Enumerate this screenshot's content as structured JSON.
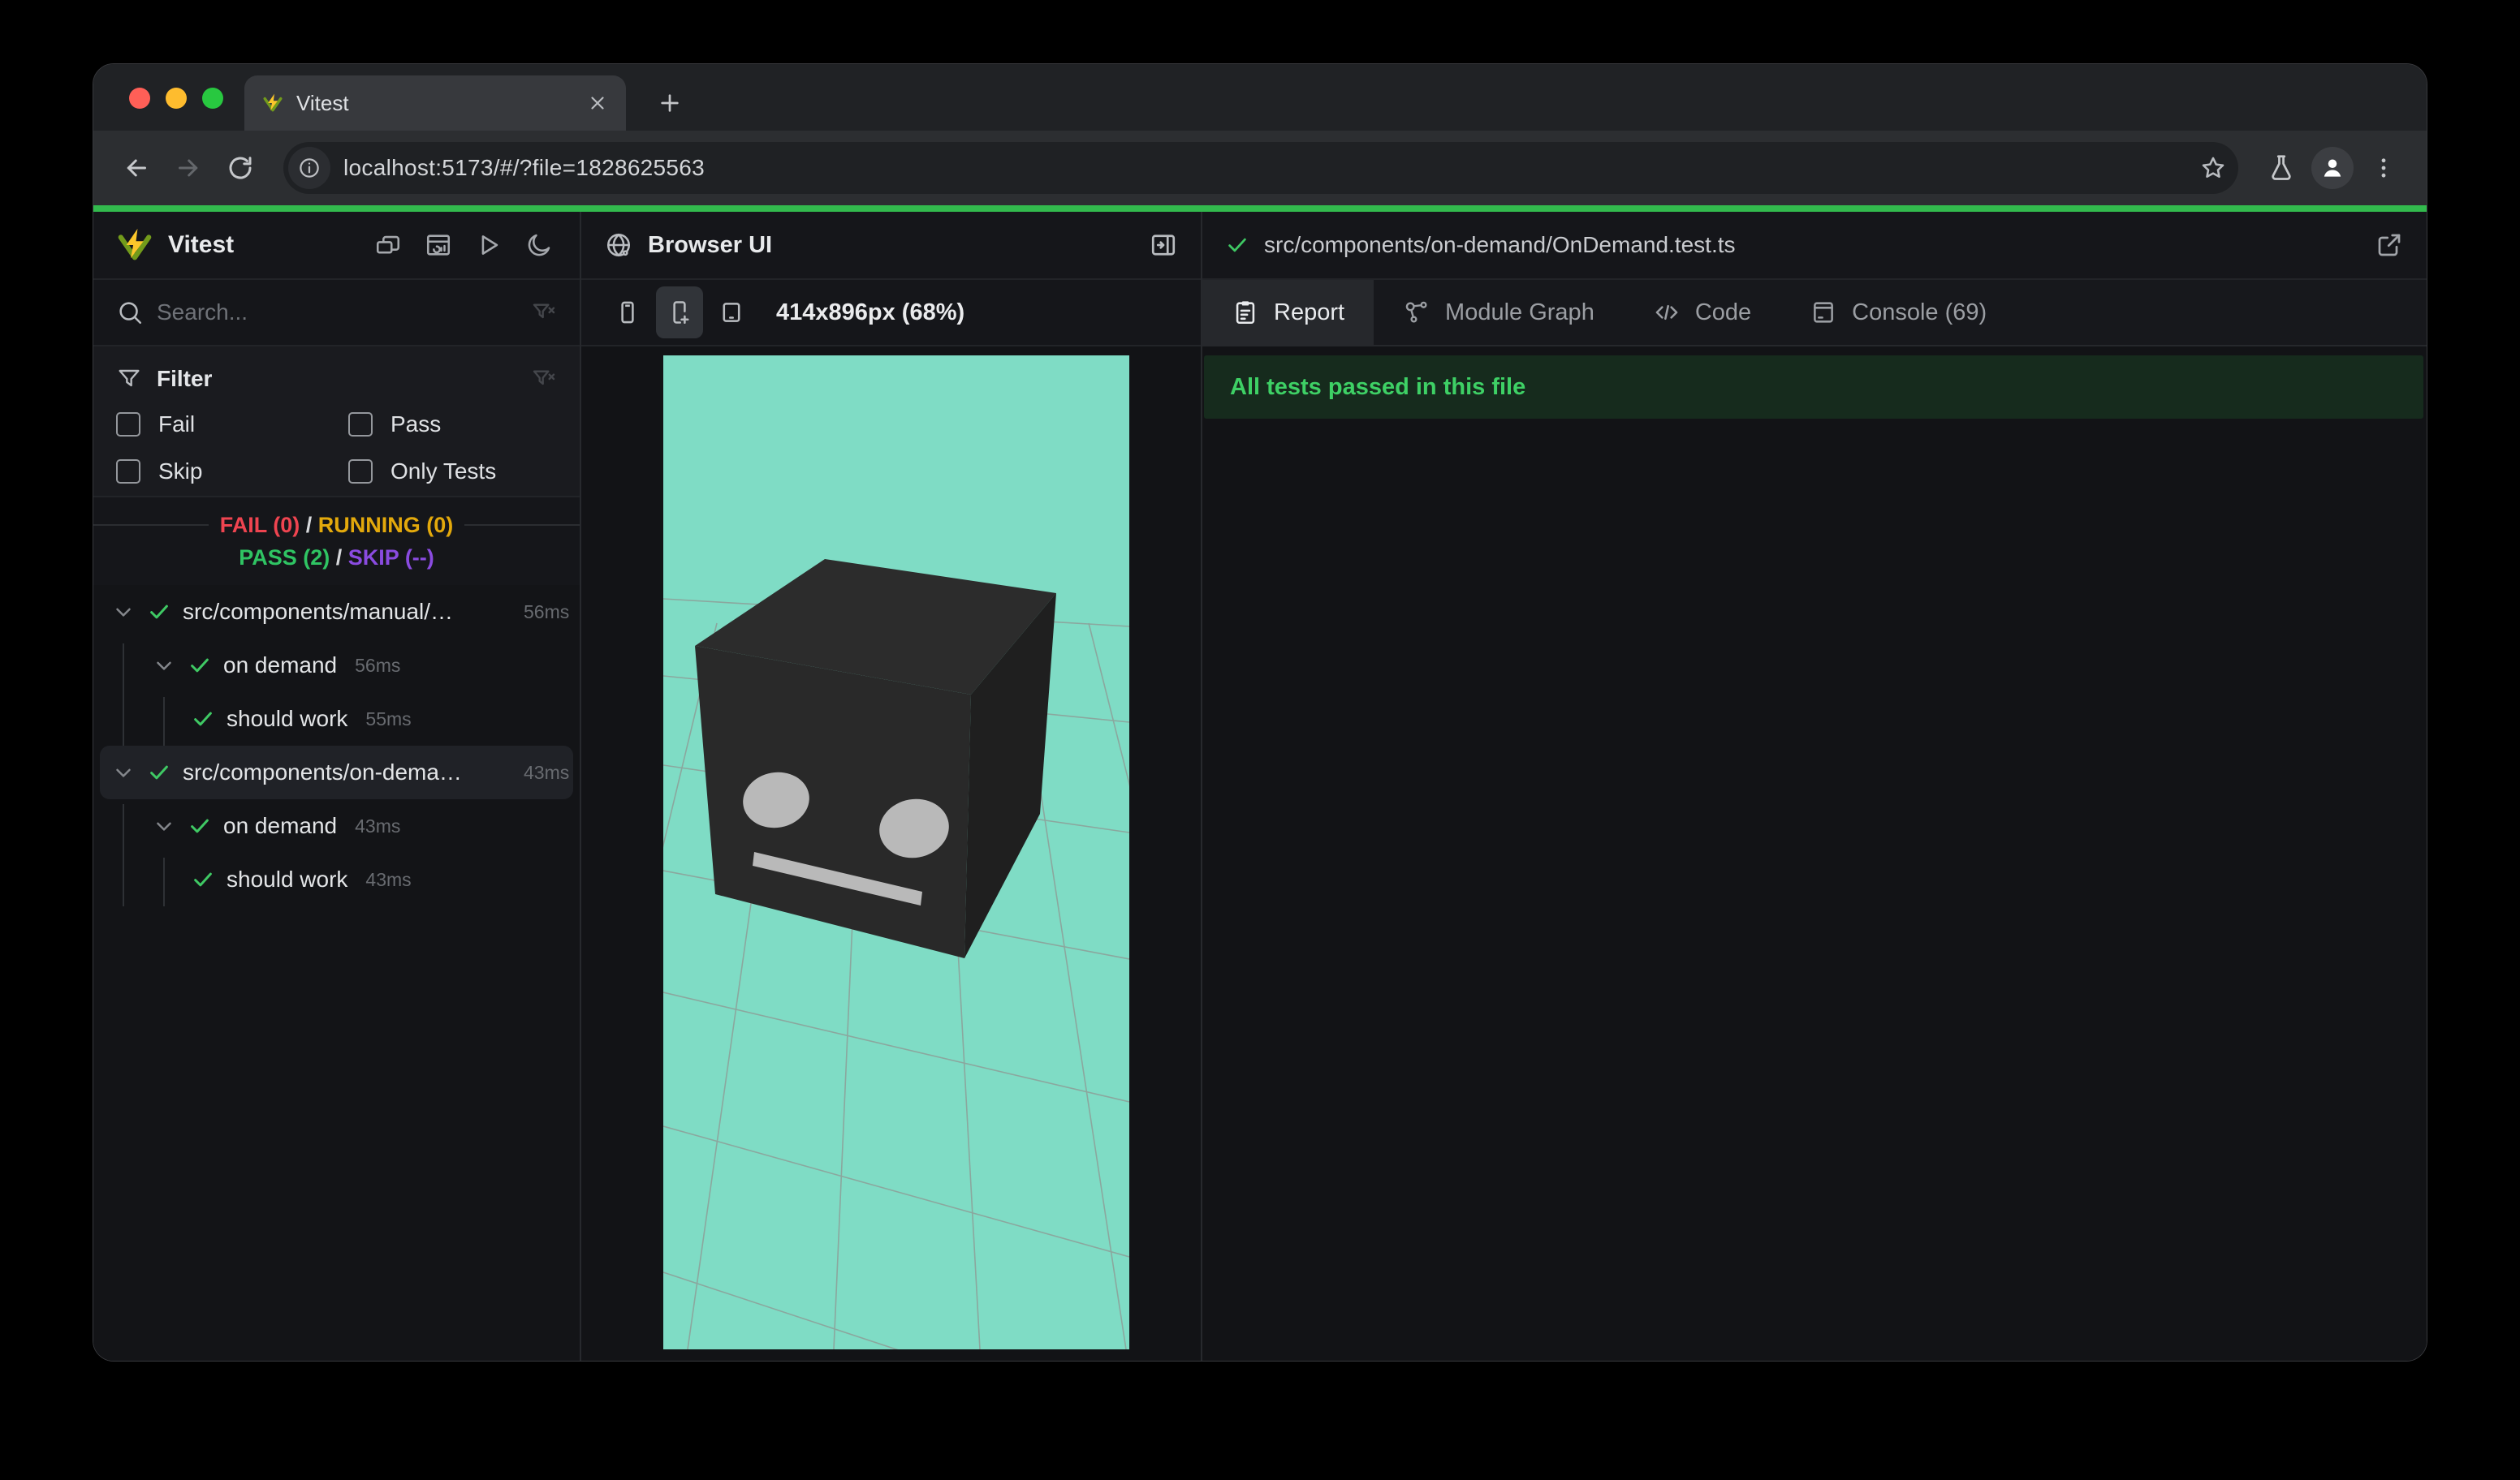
{
  "browser": {
    "tab": {
      "title": "Vitest"
    },
    "address": {
      "url": "localhost:5173/#/?file=1828625563"
    }
  },
  "sidebar": {
    "title": "Vitest",
    "search_placeholder": "Search...",
    "filter": {
      "title": "Filter",
      "options": [
        {
          "label": "Fail",
          "checked": false
        },
        {
          "label": "Pass",
          "checked": false
        },
        {
          "label": "Skip",
          "checked": false
        },
        {
          "label": "Only Tests",
          "checked": false
        }
      ]
    },
    "summary": {
      "fail": "FAIL (0)",
      "sep1": "/",
      "running": "RUNNING (0)",
      "pass": "PASS (2)",
      "sep2": "/",
      "skip": "SKIP (--)"
    },
    "tree": [
      {
        "label": "src/components/manual/…",
        "duration": "56ms",
        "level": 0,
        "has_children": true,
        "status": "pass",
        "selected": false
      },
      {
        "label": "on demand",
        "duration": "56ms",
        "level": 1,
        "has_children": true,
        "status": "pass",
        "selected": false
      },
      {
        "label": "should work",
        "duration": "55ms",
        "level": 2,
        "has_children": false,
        "status": "pass",
        "selected": false
      },
      {
        "label": "src/components/on-dema…",
        "duration": "43ms",
        "level": 0,
        "has_children": true,
        "status": "pass",
        "selected": true
      },
      {
        "label": "on demand",
        "duration": "43ms",
        "level": 1,
        "has_children": true,
        "status": "pass",
        "selected": false
      },
      {
        "label": "should work",
        "duration": "43ms",
        "level": 2,
        "has_children": false,
        "status": "pass",
        "selected": false
      }
    ]
  },
  "preview": {
    "title": "Browser UI",
    "viewport_label": "414x896px (68%)"
  },
  "details": {
    "file_path": "src/components/on-demand/OnDemand.test.ts",
    "tabs": [
      {
        "label": "Report",
        "active": true
      },
      {
        "label": "Module Graph",
        "active": false
      },
      {
        "label": "Code",
        "active": false
      },
      {
        "label": "Console (69)",
        "active": false
      }
    ],
    "banner": "All tests passed in this file"
  },
  "colors": {
    "progress_green": "#32ba4d",
    "pass_green": "#3fc964",
    "fail_red": "#ef4450",
    "running_yellow": "#e3a90c",
    "skip_purple": "#8a4be0",
    "banner_bg": "#162b1d",
    "banner_text": "#3ed065",
    "preview_bg": "#7fdcc5",
    "traffic_red": "#ff5f57",
    "traffic_yellow": "#febc2e",
    "traffic_green": "#28c840"
  },
  "icons": [
    "vitest-logo",
    "search",
    "filter-funnel",
    "clear-filter",
    "chevron-down",
    "check",
    "collapse-windows",
    "dashboard",
    "run-all",
    "dark-mode-moon",
    "globe",
    "dock-panel-right",
    "device-phone",
    "device-phone-new",
    "device-tablet",
    "report-clipboard",
    "module-graph",
    "code-brackets",
    "console-terminal",
    "external-link",
    "back-arrow",
    "forward-arrow",
    "reload",
    "site-info",
    "bookmark-star",
    "experiments-flask",
    "profile-avatar",
    "menu-kebab",
    "close-tab",
    "new-tab"
  ]
}
